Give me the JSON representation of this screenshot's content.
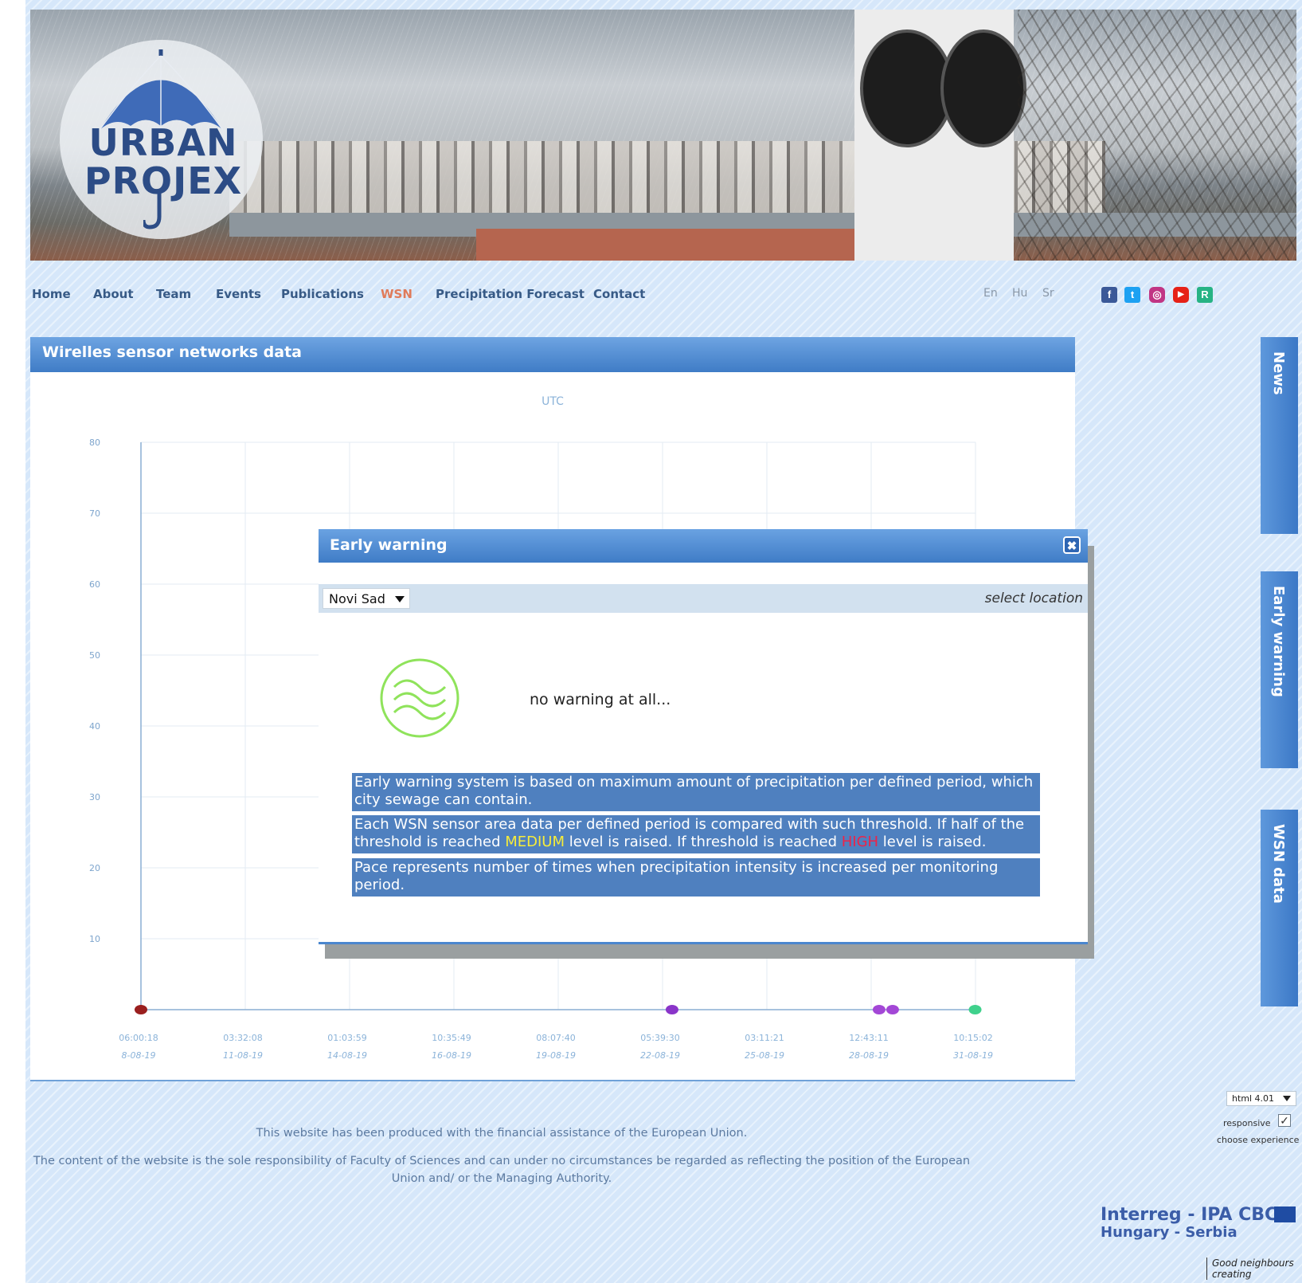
{
  "nav": {
    "items": [
      "Home",
      "About",
      "Team",
      "Events",
      "Publications",
      "WSN",
      "Precipitation Forecast",
      "Contact"
    ],
    "active": "WSN"
  },
  "languages": [
    "En",
    "Hu",
    "Sr"
  ],
  "social": [
    {
      "icon": "facebook-icon",
      "glyph": "f",
      "color": "#3b5998"
    },
    {
      "icon": "twitter-icon",
      "glyph": "t",
      "color": "#1da1f2"
    },
    {
      "icon": "instagram-icon",
      "glyph": "◎",
      "color": "#c13584"
    },
    {
      "icon": "youtube-icon",
      "glyph": "▶",
      "color": "#e62117"
    },
    {
      "icon": "researchgate-icon",
      "glyph": "R",
      "color": "#27b384"
    }
  ],
  "logo": {
    "line1": "URBAN",
    "line2": "PROJEX"
  },
  "panel": {
    "title": "Wirelles sensor networks data"
  },
  "chart_data": {
    "type": "scatter",
    "title": "UTC",
    "ylim": [
      0,
      80
    ],
    "y_ticks": [
      10,
      20,
      30,
      40,
      50,
      60,
      70,
      80
    ],
    "x_ticks": [
      {
        "time": "06:00:18",
        "date": "8-08-19"
      },
      {
        "time": "03:32:08",
        "date": "11-08-19"
      },
      {
        "time": "01:03:59",
        "date": "14-08-19"
      },
      {
        "time": "10:35:49",
        "date": "16-08-19"
      },
      {
        "time": "08:07:40",
        "date": "19-08-19"
      },
      {
        "time": "05:39:30",
        "date": "22-08-19"
      },
      {
        "time": "03:11:21",
        "date": "25-08-19"
      },
      {
        "time": "12:43:11",
        "date": "28-08-19"
      },
      {
        "time": "10:15:02",
        "date": "31-08-19"
      }
    ],
    "points": [
      {
        "date": "2019-08-08T06:00",
        "value": 0,
        "color": "#9a1f1f"
      },
      {
        "date": "2019-08-23T00:00",
        "value": 0,
        "color": "#8a35c9"
      },
      {
        "date": "2019-08-28T18:00",
        "value": 0,
        "color": "#a347d6"
      },
      {
        "date": "2019-08-29T03:00",
        "value": 0,
        "color": "#a347d6"
      },
      {
        "date": "2019-08-31T10:00",
        "value": 0,
        "color": "#3fd18c"
      }
    ],
    "grid": true
  },
  "side_tabs": [
    "News",
    "Early warning",
    "WSN data"
  ],
  "modal": {
    "title": "Early warning",
    "close_glyph": "✖",
    "location_value": "Novi Sad",
    "location_hint": "select location",
    "status_text": "no warning at all...",
    "info1": "Early warning system is based on maximum amount of precipitation per defined period, which city sewage can contain.",
    "info2_a": "Each WSN sensor area data per defined period is compared with such threshold. If half of the threshold is reached ",
    "info2_medium": "MEDIUM",
    "info2_b": " level is raised. If threshold is reached ",
    "info2_high": "HIGH",
    "info2_c": " level is raised.",
    "info3": "Pace represents number of times when precipitation intensity is increased per monitoring period."
  },
  "footer": {
    "line1": "This website has been produced with the financial assistance of the European Union.",
    "line2": "The content of the website is the sole responsibility of Faculty of Sciences and can under no circumstances be regarded as reflecting the position of the European Union and/ or the Managing Authority.",
    "version_select": "html 4.01",
    "responsive_label": "responsive",
    "responsive_check": "✓",
    "choose_label": "choose experience",
    "interreg_line1": "Interreg - IPA CBC",
    "interreg_line2": "Hungary - Serbia",
    "tagline": "Good neighbours creating"
  }
}
